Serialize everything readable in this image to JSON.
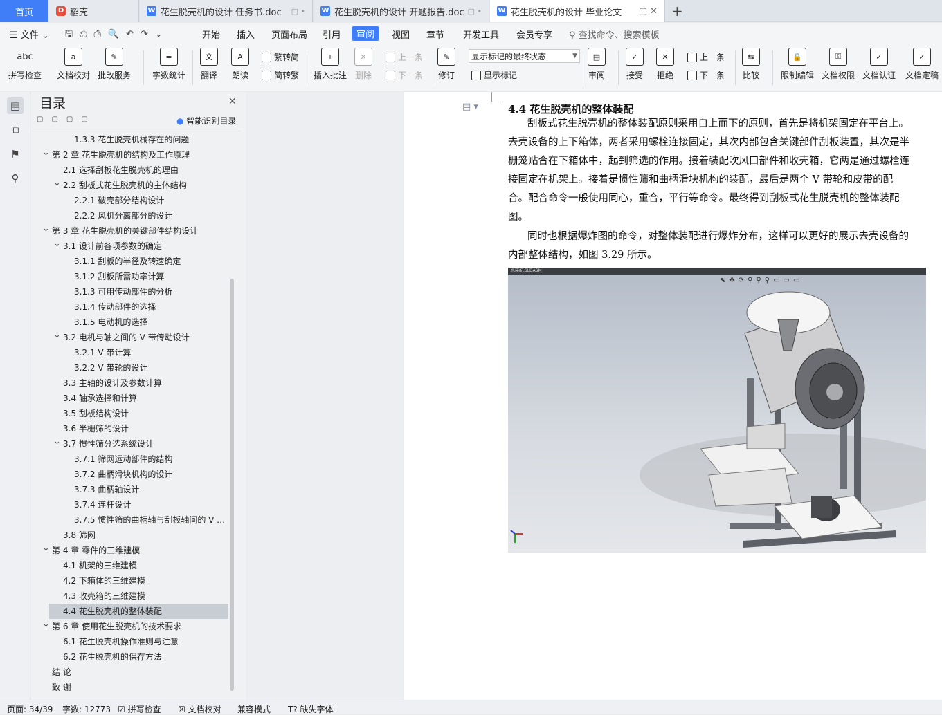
{
  "tabs": {
    "home": "首页",
    "daoke": "稻壳",
    "doc1": "花生脱壳机的设计 任务书.doc",
    "doc2": "花生脱壳机的设计 开题报告.doc",
    "doc3": "花生脱壳机的设计 毕业论文",
    "new": "+"
  },
  "menu": {
    "file": "文件",
    "items": [
      "开始",
      "插入",
      "页面布局",
      "引用",
      "审阅",
      "视图",
      "章节",
      "开发工具",
      "会员专享"
    ],
    "search": "查找命令、搜索模板"
  },
  "ribbon": {
    "spell": "拼写检查",
    "proof": "文档校对",
    "batch": "批改服务",
    "count": "字数统计",
    "translate": "翻译",
    "read": "朗读",
    "trad": "繁转简",
    "simp": "简转繁",
    "insert_comment": "插入批注",
    "delete": "删除",
    "prev1": "上一条",
    "next1": "下一条",
    "revise": "修订",
    "markup_state": "显示标记的最终状态",
    "show_markup": "显示标记",
    "review": "审阅",
    "accept": "接受",
    "reject": "拒绝",
    "prev2": "上一条",
    "next2": "下一条",
    "compare": "比较",
    "restrict": "限制编辑",
    "perm": "文档权限",
    "cert": "文档认证",
    "final": "文档定稿"
  },
  "toc": {
    "title": "目录",
    "smart": "智能识别目录",
    "items": [
      {
        "t": "1.3.3  花生脱壳机械存在的问题",
        "lv": 3
      },
      {
        "t": "第 2 章  花生脱壳机的结构及工作原理",
        "lv": 1
      },
      {
        "t": "2.1  选择刮板花生脱壳机的理由",
        "lv": 2
      },
      {
        "t": "2.2  刮板式花生脱壳机的主体结构",
        "lv": 2,
        "exp": true
      },
      {
        "t": "2.2.1  破壳部分结构设计",
        "lv": 3
      },
      {
        "t": "2.2.2  风机分离部分的设计",
        "lv": 3
      },
      {
        "t": "第 3 章  花生脱壳机的关键部件结构设计",
        "lv": 1
      },
      {
        "t": "3.1  设计前各项参数的确定",
        "lv": 2,
        "exp": true
      },
      {
        "t": "3.1.1  刮板的半径及转速确定",
        "lv": 3
      },
      {
        "t": "3.1.2  刮板所需功率计算",
        "lv": 3
      },
      {
        "t": "3.1.3  可用传动部件的分析",
        "lv": 3
      },
      {
        "t": "3.1.4  传动部件的选择",
        "lv": 3
      },
      {
        "t": "3.1.5  电动机的选择",
        "lv": 3
      },
      {
        "t": "3.2  电机与轴之间的 V 带传动设计",
        "lv": 2,
        "exp": true
      },
      {
        "t": "3.2.1 V 带计算",
        "lv": 3
      },
      {
        "t": "3.2.2 V 带轮的设计",
        "lv": 3
      },
      {
        "t": "3.3  主轴的设计及参数计算",
        "lv": 2
      },
      {
        "t": "3.4  轴承选择和计算",
        "lv": 2
      },
      {
        "t": "3.5  刮板结构设计",
        "lv": 2
      },
      {
        "t": "3.6  半栅筛的设计",
        "lv": 2
      },
      {
        "t": "3.7  惯性筛分选系统设计",
        "lv": 2,
        "exp": true
      },
      {
        "t": "3.7.1  筛网运动部件的结构",
        "lv": 3
      },
      {
        "t": "3.7.2  曲柄滑块机构的设计",
        "lv": 3
      },
      {
        "t": "3.7.3  曲柄轴设计",
        "lv": 3
      },
      {
        "t": "3.7.4  连杆设计",
        "lv": 3
      },
      {
        "t": "3.7.5  惯性筛的曲柄轴与刮板轴间的 V …",
        "lv": 3
      },
      {
        "t": "3.8  筛网",
        "lv": 2
      },
      {
        "t": "第 4 章  零件的三维建模",
        "lv": 1
      },
      {
        "t": "4.1  机架的三维建模",
        "lv": 2
      },
      {
        "t": "4.2  下箱体的三维建模",
        "lv": 2
      },
      {
        "t": "4.3  收壳箱的三维建模",
        "lv": 2
      },
      {
        "t": "4.4  花生脱壳机的整体装配",
        "lv": 2,
        "hl": true
      },
      {
        "t": "第 6 章  使用花生脱壳机的技术要求",
        "lv": 1
      },
      {
        "t": "6.1  花生脱壳机操作准则与注意",
        "lv": 2
      },
      {
        "t": "6.2  花生脱壳机的保存方法",
        "lv": 2
      },
      {
        "t": "结    论",
        "lv": 1,
        "noexp": true
      },
      {
        "t": "致    谢",
        "lv": 1,
        "noexp": true
      }
    ]
  },
  "doc": {
    "heading": "4.4  花生脱壳机的整体装配",
    "lines": [
      "刮板式花生脱壳机的整体装配原则采用自上而下的原则，首先是将机架固定在平台上。",
      "去壳设备的上下箱体，两者采用螺栓连接固定，其次内部包含关键部件刮板装置，其次是半",
      "栅笼贴合在下箱体中，起到筛选的作用。接着装配吹风口部件和收壳箱，它两是通过螺栓连",
      "接固定在机架上。接着是惯性筛和曲柄滑块机构的装配，最后是两个 V 带轮和皮带的配",
      "合。配合命令一般使用同心，重合，平行等命令。最终得到刮板式花生脱壳机的整体装配",
      "图。",
      "同时也根据爆炸图的命令，对整体装配进行爆炸分布，这样可以更好的展示去壳设备的",
      "内部整体结构，如图 3.29 所示。"
    ],
    "figtab": "总装配.SLDASM"
  },
  "status": {
    "page": "页面: 34/39",
    "words": "字数: 12773",
    "spell": "拼写检查",
    "proof": "文档校对",
    "compat": "兼容模式",
    "font": "缺失字体"
  }
}
